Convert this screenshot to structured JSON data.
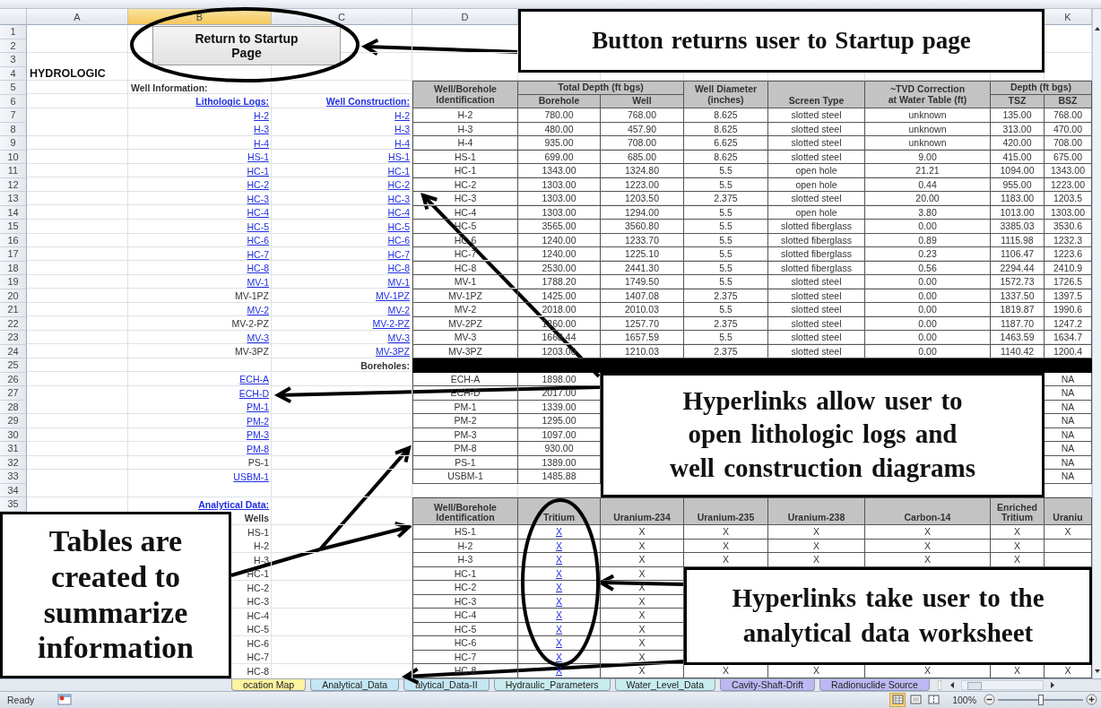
{
  "column_headers": [
    {
      "label": "A",
      "selected": false
    },
    {
      "label": "B",
      "selected": true
    },
    {
      "label": "C",
      "selected": false
    },
    {
      "label": "D",
      "selected": false
    },
    {
      "label": "K",
      "selected": false
    }
  ],
  "row_numbers": [
    "1",
    "2",
    "3",
    "4",
    "5",
    "6",
    "7",
    "8",
    "9",
    "10",
    "11",
    "12",
    "13",
    "14",
    "15",
    "16",
    "17",
    "18",
    "19",
    "20",
    "21",
    "22",
    "23",
    "24",
    "25",
    "26",
    "27",
    "28",
    "29",
    "30",
    "31",
    "32",
    "33",
    "34",
    "35"
  ],
  "startup_button": "Return to Startup Page",
  "sheet_title": "HYDROLOGIC",
  "well_information_label": "Well Information:",
  "lithologic_logs_link": "Lithologic Logs:",
  "well_construction_link": "Well Construction:",
  "well_table": {
    "id_header": "Well/Borehole\nIdentification",
    "total_depth_header": "Total Depth (ft bgs)",
    "borehole_header": "Borehole",
    "well_header": "Well",
    "diameter_header": "Well Diameter\n(inches)",
    "screen_type_header": "Screen Type",
    "tvd_header": "~TVD Correction\nat Water Table (ft)",
    "depth_header": "Depth (ft bgs)",
    "tsz_header": "TSZ",
    "bsz_header": "BSZ",
    "rows": [
      {
        "log": "H-2",
        "log_link": true,
        "construction": "H-2",
        "construction_link": true,
        "id": "H-2",
        "borehole": "780.00",
        "well": "768.00",
        "diameter": "8.625",
        "screen": "slotted steel",
        "tvd": "unknown",
        "tsz": "135.00",
        "bsz": "768.00"
      },
      {
        "log": "H-3",
        "log_link": true,
        "construction": "H-3",
        "construction_link": true,
        "id": "H-3",
        "borehole": "480.00",
        "well": "457.90",
        "diameter": "8.625",
        "screen": "slotted steel",
        "tvd": "unknown",
        "tsz": "313.00",
        "bsz": "470.00"
      },
      {
        "log": "H-4",
        "log_link": true,
        "construction": "H-4",
        "construction_link": true,
        "id": "H-4",
        "borehole": "935.00",
        "well": "708.00",
        "diameter": "6.625",
        "screen": "slotted steel",
        "tvd": "unknown",
        "tsz": "420.00",
        "bsz": "708.00"
      },
      {
        "log": "HS-1",
        "log_link": true,
        "construction": "HS-1",
        "construction_link": true,
        "id": "HS-1",
        "borehole": "699.00",
        "well": "685.00",
        "diameter": "8.625",
        "screen": "slotted steel",
        "tvd": "9.00",
        "tsz": "415.00",
        "bsz": "675.00"
      },
      {
        "log": "HC-1",
        "log_link": true,
        "construction": "HC-1",
        "construction_link": true,
        "id": "HC-1",
        "borehole": "1343.00",
        "well": "1324.80",
        "diameter": "5.5",
        "screen": "open hole",
        "tvd": "21.21",
        "tsz": "1094.00",
        "bsz": "1343.00"
      },
      {
        "log": "HC-2",
        "log_link": true,
        "construction": "HC-2",
        "construction_link": true,
        "id": "HC-2",
        "borehole": "1303.00",
        "well": "1223.00",
        "diameter": "5.5",
        "screen": "open hole",
        "tvd": "0.44",
        "tsz": "955.00",
        "bsz": "1223.00"
      },
      {
        "log": "HC-3",
        "log_link": true,
        "construction": "HC-3",
        "construction_link": true,
        "id": "HC-3",
        "borehole": "1303.00",
        "well": "1203.50",
        "diameter": "2.375",
        "screen": "slotted steel",
        "tvd": "20.00",
        "tsz": "1183.00",
        "bsz": "1203.5"
      },
      {
        "log": "HC-4",
        "log_link": true,
        "construction": "HC-4",
        "construction_link": true,
        "id": "HC-4",
        "borehole": "1303.00",
        "well": "1294.00",
        "diameter": "5.5",
        "screen": "open hole",
        "tvd": "3.80",
        "tsz": "1013.00",
        "bsz": "1303.00"
      },
      {
        "log": "HC-5",
        "log_link": true,
        "construction": "HC-5",
        "construction_link": true,
        "id": "HC-5",
        "borehole": "3565.00",
        "well": "3560.80",
        "diameter": "5.5",
        "screen": "slotted fiberglass",
        "tvd": "0.00",
        "tsz": "3385.03",
        "bsz": "3530.6"
      },
      {
        "log": "HC-6",
        "log_link": true,
        "construction": "HC-6",
        "construction_link": true,
        "id": "HC-6",
        "borehole": "1240.00",
        "well": "1233.70",
        "diameter": "5.5",
        "screen": "slotted fiberglass",
        "tvd": "0.89",
        "tsz": "1115.98",
        "bsz": "1232.3"
      },
      {
        "log": "HC-7",
        "log_link": true,
        "construction": "HC-7",
        "construction_link": true,
        "id": "HC-7",
        "borehole": "1240.00",
        "well": "1225.10",
        "diameter": "5.5",
        "screen": "slotted fiberglass",
        "tvd": "0.23",
        "tsz": "1106.47",
        "bsz": "1223.6"
      },
      {
        "log": "HC-8",
        "log_link": true,
        "construction": "HC-8",
        "construction_link": true,
        "id": "HC-8",
        "borehole": "2530.00",
        "well": "2441.30",
        "diameter": "5.5",
        "screen": "slotted fiberglass",
        "tvd": "0.56",
        "tsz": "2294.44",
        "bsz": "2410.9"
      },
      {
        "log": "MV-1",
        "log_link": true,
        "construction": "MV-1",
        "construction_link": true,
        "id": "MV-1",
        "borehole": "1788.20",
        "well": "1749.50",
        "diameter": "5.5",
        "screen": "slotted steel",
        "tvd": "0.00",
        "tsz": "1572.73",
        "bsz": "1726.5"
      },
      {
        "log": "MV-1PZ",
        "log_link": false,
        "construction": "MV-1PZ",
        "construction_link": true,
        "id": "MV-1PZ",
        "borehole": "1425.00",
        "well": "1407.08",
        "diameter": "2.375",
        "screen": "slotted steel",
        "tvd": "0.00",
        "tsz": "1337.50",
        "bsz": "1397.5"
      },
      {
        "log": "MV-2",
        "log_link": true,
        "construction": "MV-2",
        "construction_link": true,
        "id": "MV-2",
        "borehole": "2018.00",
        "well": "2010.03",
        "diameter": "5.5",
        "screen": "slotted steel",
        "tvd": "0.00",
        "tsz": "1819.87",
        "bsz": "1990.6"
      },
      {
        "log": "MV-2-PZ",
        "log_link": false,
        "construction": "MV-2-PZ",
        "construction_link": true,
        "id": "MV-2PZ",
        "borehole": "1260.00",
        "well": "1257.70",
        "diameter": "2.375",
        "screen": "slotted steel",
        "tvd": "0.00",
        "tsz": "1187.70",
        "bsz": "1247.2"
      },
      {
        "log": "MV-3",
        "log_link": true,
        "construction": "MV-3",
        "construction_link": true,
        "id": "MV-3",
        "borehole": "1668.44",
        "well": "1657.59",
        "diameter": "5.5",
        "screen": "slotted steel",
        "tvd": "0.00",
        "tsz": "1463.59",
        "bsz": "1634.7"
      },
      {
        "log": "MV-3PZ",
        "log_link": false,
        "construction": "MV-3PZ",
        "construction_link": true,
        "id": "MV-3PZ",
        "borehole": "1203.00",
        "well": "1210.03",
        "diameter": "2.375",
        "screen": "slotted steel",
        "tvd": "0.00",
        "tsz": "1140.42",
        "bsz": "1200.4"
      }
    ]
  },
  "boreholes_label": "Boreholes:",
  "borehole_rows": [
    {
      "log": "ECH-A",
      "log_link": true,
      "id": "ECH-A",
      "borehole": "1898.00",
      "depth": "NA"
    },
    {
      "log": "ECH-D",
      "log_link": true,
      "id": "ECH-D",
      "borehole": "2017.00",
      "depth": "NA"
    },
    {
      "log": "PM-1",
      "log_link": true,
      "id": "PM-1",
      "borehole": "1339.00",
      "depth": "NA"
    },
    {
      "log": "PM-2",
      "log_link": true,
      "id": "PM-2",
      "borehole": "1295.00",
      "depth": "NA"
    },
    {
      "log": "PM-3",
      "log_link": true,
      "id": "PM-3",
      "borehole": "1097.00",
      "depth": "NA"
    },
    {
      "log": "PM-8",
      "log_link": true,
      "id": "PM-8",
      "borehole": "930.00",
      "depth": "NA"
    },
    {
      "log": "PS-1",
      "log_link": false,
      "id": "PS-1",
      "borehole": "1389.00",
      "depth": "NA"
    },
    {
      "log": "USBM-1",
      "log_link": true,
      "id": "USBM-1",
      "borehole": "1485.88",
      "depth": "NA"
    }
  ],
  "analytical_data_link": "Analytical Data:",
  "wells_label": "Wells",
  "analytical_table": {
    "headers": [
      "Well/Borehole\nIdentification",
      "Tritium",
      "Uranium-234",
      "Uranium-235",
      "Uranium-238",
      "Carbon-14",
      "Enriched\nTritium",
      "Uraniu"
    ],
    "rows": [
      {
        "well": "HS-1",
        "id": "HS-1",
        "cells": [
          {
            "text": "X",
            "link": true
          },
          {
            "text": "X",
            "link": false
          },
          {
            "text": "X",
            "link": false
          },
          {
            "text": "X",
            "link": false
          },
          {
            "text": "X",
            "link": false
          },
          {
            "text": "X",
            "link": false
          },
          {
            "text": "X",
            "link": false
          }
        ]
      },
      {
        "well": "H-2",
        "id": "H-2",
        "cells": [
          {
            "text": "X",
            "link": true
          },
          {
            "text": "X",
            "link": false
          },
          {
            "text": "X",
            "link": false
          },
          {
            "text": "X",
            "link": false
          },
          {
            "text": "X",
            "link": false
          },
          {
            "text": "X",
            "link": false
          }
        ]
      },
      {
        "well": "H-3",
        "id": "H-3",
        "cells": [
          {
            "text": "X",
            "link": true
          },
          {
            "text": "X",
            "link": false
          },
          {
            "text": "X",
            "link": false
          },
          {
            "text": "X",
            "link": false
          },
          {
            "text": "X",
            "link": false
          },
          {
            "text": "X",
            "link": false
          }
        ]
      },
      {
        "well": "HC-1",
        "id": "HC-1",
        "cells": [
          {
            "text": "X",
            "link": true
          },
          {
            "text": "X",
            "link": false
          }
        ]
      },
      {
        "well": "HC-2",
        "id": "HC-2",
        "cells": [
          {
            "text": "X",
            "link": true
          },
          {
            "text": "X",
            "link": false
          }
        ]
      },
      {
        "well": "HC-3",
        "id": "HC-3",
        "cells": [
          {
            "text": "X",
            "link": true
          },
          {
            "text": "X",
            "link": false
          }
        ]
      },
      {
        "well": "HC-4",
        "id": "HC-4",
        "cells": [
          {
            "text": "X",
            "link": true
          },
          {
            "text": "X",
            "link": false
          }
        ]
      },
      {
        "well": "HC-5",
        "id": "HC-5",
        "cells": [
          {
            "text": "X",
            "link": true
          },
          {
            "text": "X",
            "link": false
          }
        ]
      },
      {
        "well": "HC-6",
        "id": "HC-6",
        "cells": [
          {
            "text": "X",
            "link": true
          },
          {
            "text": "X",
            "link": false
          }
        ]
      },
      {
        "well": "HC-7",
        "id": "HC-7",
        "cells": [
          {
            "text": "X",
            "link": true
          },
          {
            "text": "X",
            "link": false
          }
        ]
      },
      {
        "well": "HC-8",
        "id": "HC-8",
        "cells": [
          {
            "text": "X",
            "link": true
          },
          {
            "text": "X",
            "link": false
          },
          {
            "text": "X",
            "link": false
          },
          {
            "text": "X",
            "link": false
          },
          {
            "text": "X",
            "link": false
          },
          {
            "text": "X",
            "link": false
          },
          {
            "text": "X",
            "link": false
          }
        ]
      }
    ]
  },
  "sheet_tabs": [
    {
      "label": "ocation Map",
      "color": "#fdf3a0"
    },
    {
      "label": "Analytical_Data",
      "color": "#c5e6f3"
    },
    {
      "label": "alytical_Data-II",
      "color": "#c5e6f3"
    },
    {
      "label": "Hydraulic_Parameters",
      "color": "#c8ecee"
    },
    {
      "label": "Water_Level_Data",
      "color": "#c8ecee"
    },
    {
      "label": "Cavity-Shaft-Drift",
      "color": "#bdb8f2"
    },
    {
      "label": "Radionuclide Source",
      "color": "#bdb8f2"
    }
  ],
  "callouts": [
    "Button returns  user to Startup page",
    "Hyperlinks  allow user to\nopen lithologic logs and\nwell construction diagrams",
    "Tables are\ncreated to\nsummarize\ninformation",
    "Hyperlinks  take user to the\nanalytical data worksheet"
  ],
  "status_bar": {
    "status": "Ready",
    "view_buttons": [
      {
        "selected": true
      },
      {
        "selected": false
      },
      {
        "selected": false
      }
    ],
    "zoom": "100%",
    "zoom_slider": {
      "level": 0.5
    }
  }
}
